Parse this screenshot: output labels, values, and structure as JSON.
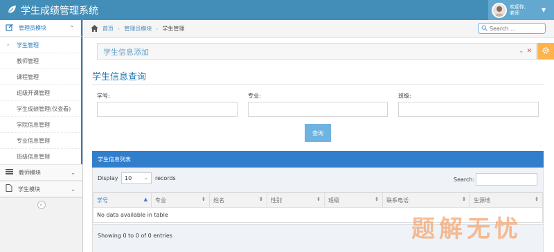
{
  "app": {
    "title": "学生成绩管理系统",
    "user_greeting": "欢迎你,",
    "user_name": "老师"
  },
  "sidebar": {
    "sections": [
      {
        "label": "管理员模块",
        "icon": "edit-icon",
        "expanded": true,
        "items": [
          {
            "label": "学生管理",
            "active": true
          },
          {
            "label": "教师管理"
          },
          {
            "label": "课程管理"
          },
          {
            "label": "班级开课管理"
          },
          {
            "label": "学生成绩管理(仅查看)"
          },
          {
            "label": "学院信息管理"
          },
          {
            "label": "专业信息管理"
          },
          {
            "label": "班级信息管理"
          }
        ]
      },
      {
        "label": "教师模块",
        "icon": "list-icon"
      },
      {
        "label": "学生模块",
        "icon": "file-icon"
      }
    ],
    "collapse_symbol": "«"
  },
  "breadcrumb": {
    "home": "首页",
    "module": "管理员模块",
    "current": "学生管理"
  },
  "nav_search": {
    "placeholder": "Search ..."
  },
  "add_panel": {
    "title": "学生信息添加"
  },
  "query": {
    "title": "学生信息查询",
    "fields": [
      {
        "label": "学号:"
      },
      {
        "label": "专业:"
      },
      {
        "label": "班级:"
      }
    ],
    "button": "查询"
  },
  "table": {
    "title": "学生信息列表",
    "display_label": "Display",
    "page_size": "10",
    "records_label": "records",
    "search_label": "Search:",
    "columns": [
      "学号",
      "专业",
      "姓名",
      "性别",
      "班级",
      "联系电话",
      "生源地"
    ],
    "empty_message": "No data available in table",
    "info": "Showing 0 to 0 of 0 entries"
  },
  "watermark": {
    "text": [
      "题",
      "解",
      "无",
      "忧"
    ]
  },
  "colors": {
    "navbar": "#438eb9",
    "accent": "#2b7dbc",
    "table_header": "#307ecc",
    "button": "#6fb3e0",
    "settings": "#ffb44b"
  }
}
